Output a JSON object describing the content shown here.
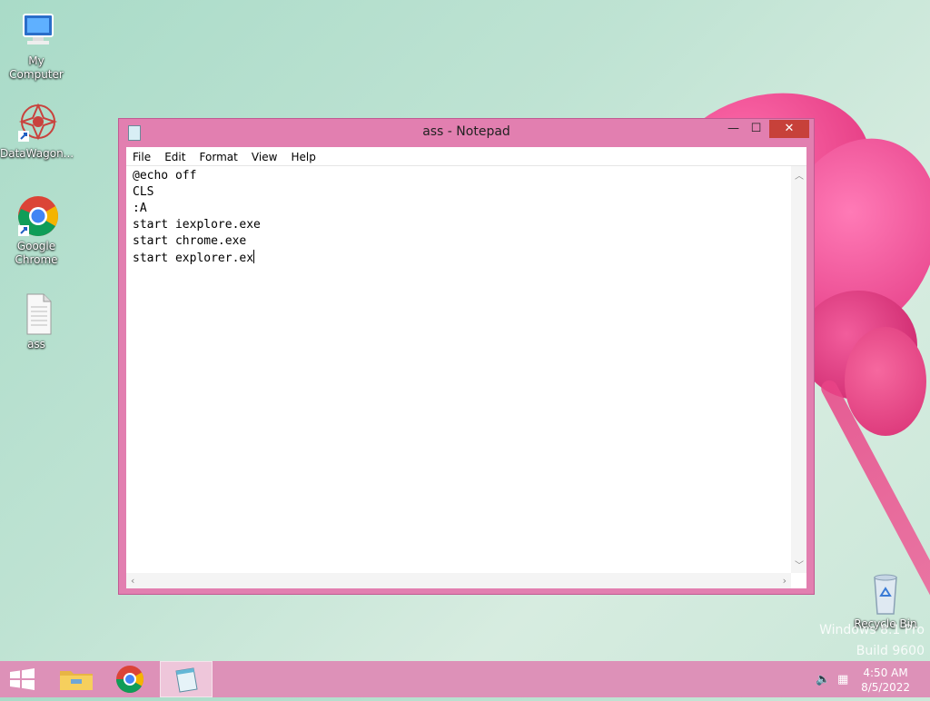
{
  "desktop": {
    "icons": [
      {
        "label": "My Computer",
        "icon": "computer-icon"
      },
      {
        "label": "DataWagon...",
        "icon": "datawagon-icon"
      },
      {
        "label": "Google Chrome",
        "icon": "chrome-icon"
      },
      {
        "label": "ass",
        "icon": "text-file-icon"
      }
    ],
    "recycle_bin": {
      "label": "Recycle Bin",
      "icon": "recycle-bin-icon"
    },
    "watermark": {
      "line1": "Windows 8.1 Pro",
      "line2": "Build 9600"
    }
  },
  "notepad": {
    "title": "ass - Notepad",
    "controls": {
      "minimize": "—",
      "maximize": "☐",
      "close": "✕"
    },
    "menu": [
      "File",
      "Edit",
      "Format",
      "View",
      "Help"
    ],
    "lines": [
      "@echo off",
      "CLS",
      ":A",
      "start iexplore.exe",
      "start chrome.exe",
      "start explorer.ex"
    ]
  },
  "taskbar": {
    "start": "start-icon",
    "items": [
      "file-explorer-icon",
      "chrome-icon",
      "notepad-icon"
    ],
    "active_item": "notepad",
    "time": "4:50 AM",
    "date": "8/5/2022"
  },
  "colors": {
    "window_frame": "#e27fb0",
    "close_button": "#c7413a",
    "taskbar": "#dd91b8"
  }
}
